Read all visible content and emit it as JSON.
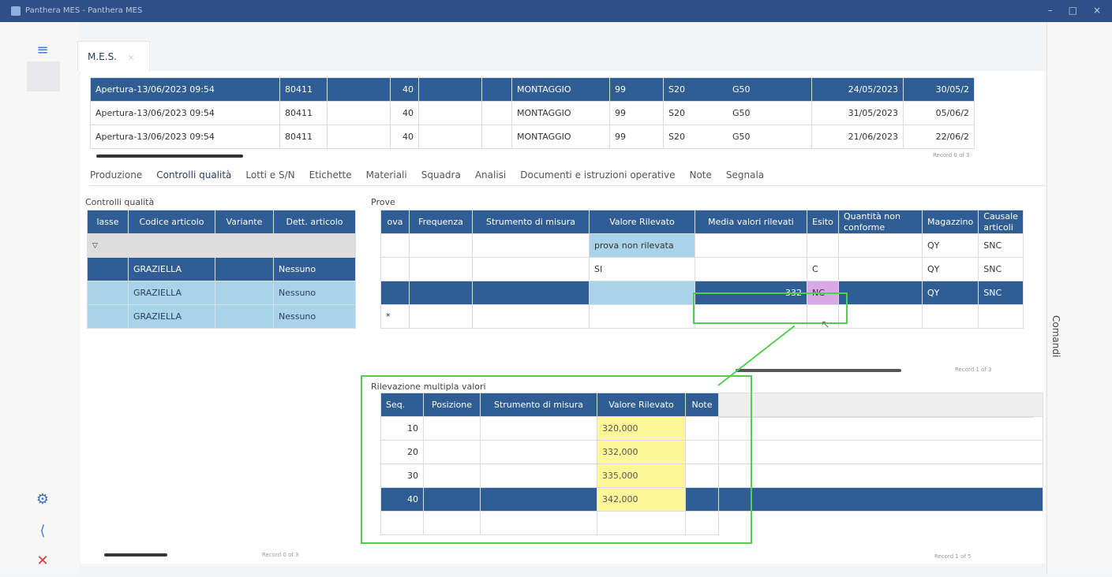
{
  "window": {
    "title": "Panthera MES - Panthera MES",
    "controls": [
      "–",
      "□",
      "×"
    ]
  },
  "tab_mes": {
    "label": "M.E.S.",
    "close": "×"
  },
  "top_rows": [
    {
      "desc": "Apertura-13/06/2023 09:54",
      "code": "80411",
      "qty": "40",
      "phase": "MONTAGGIO",
      "n1": "99",
      "c1": "S20",
      "c2": "G50",
      "d1": "24/05/2023",
      "d2": "30/05/2"
    },
    {
      "desc": "Apertura-13/06/2023 09:54",
      "code": "80411",
      "qty": "40",
      "phase": "MONTAGGIO",
      "n1": "99",
      "c1": "S20",
      "c2": "G50",
      "d1": "31/05/2023",
      "d2": "05/06/2"
    },
    {
      "desc": "Apertura-13/06/2023 09:54",
      "code": "80411",
      "qty": "40",
      "phase": "MONTAGGIO",
      "n1": "99",
      "c1": "S20",
      "c2": "G50",
      "d1": "21/06/2023",
      "d2": "22/06/2"
    }
  ],
  "top_pager": "Record 0 of 3",
  "tabs": [
    "Produzione",
    "Controlli qualità",
    "Lotti e S/N",
    "Etichette",
    "Materiali",
    "Squadra",
    "Analisi",
    "Documenti e istruzioni operative",
    "Note",
    "Segnala"
  ],
  "controlli": {
    "label": "Controlli qualità",
    "headers": [
      "lasse",
      "Codice articolo",
      "Variante",
      "Dett. articolo"
    ],
    "rows": [
      {
        "code": "GRAZIELLA",
        "dett": "Nessuno"
      },
      {
        "code": "GRAZIELLA",
        "dett": "Nessuno"
      },
      {
        "code": "GRAZIELLA",
        "dett": "Nessuno"
      }
    ],
    "pager": "Record 0 of 3"
  },
  "prove": {
    "label": "Prove",
    "headers": [
      "ova",
      "Frequenza",
      "Strumento di misura",
      "Valore Rilevato",
      "Media valori rilevati",
      "Esito",
      "Quantità non conforme",
      "Magazzino",
      "Causale articoli"
    ],
    "rows": [
      {
        "valore": "prova non rilevata",
        "media": "",
        "esito": "",
        "mag": "QY",
        "caus": "SNC"
      },
      {
        "valore": "SI",
        "media": "",
        "esito": "C",
        "mag": "QY",
        "caus": "SNC"
      },
      {
        "valore": "",
        "media": "332",
        "esito": "NC",
        "mag": "QY",
        "caus": "SNC"
      }
    ],
    "pager": "Record 1 of 3",
    "pager2": "Record 1 of 5"
  },
  "rilevazione": {
    "label": "Rilevazione multipla valori",
    "headers": [
      "Seq.",
      "Posizione",
      "Strumento di misura",
      "Valore Rilevato",
      "Note"
    ],
    "rows": [
      {
        "seq": "10",
        "val": "320,000"
      },
      {
        "seq": "20",
        "val": "332,000"
      },
      {
        "seq": "30",
        "val": "335,000"
      },
      {
        "seq": "40",
        "val": "342,000"
      }
    ]
  },
  "side": {
    "comandi": "Comandi"
  }
}
